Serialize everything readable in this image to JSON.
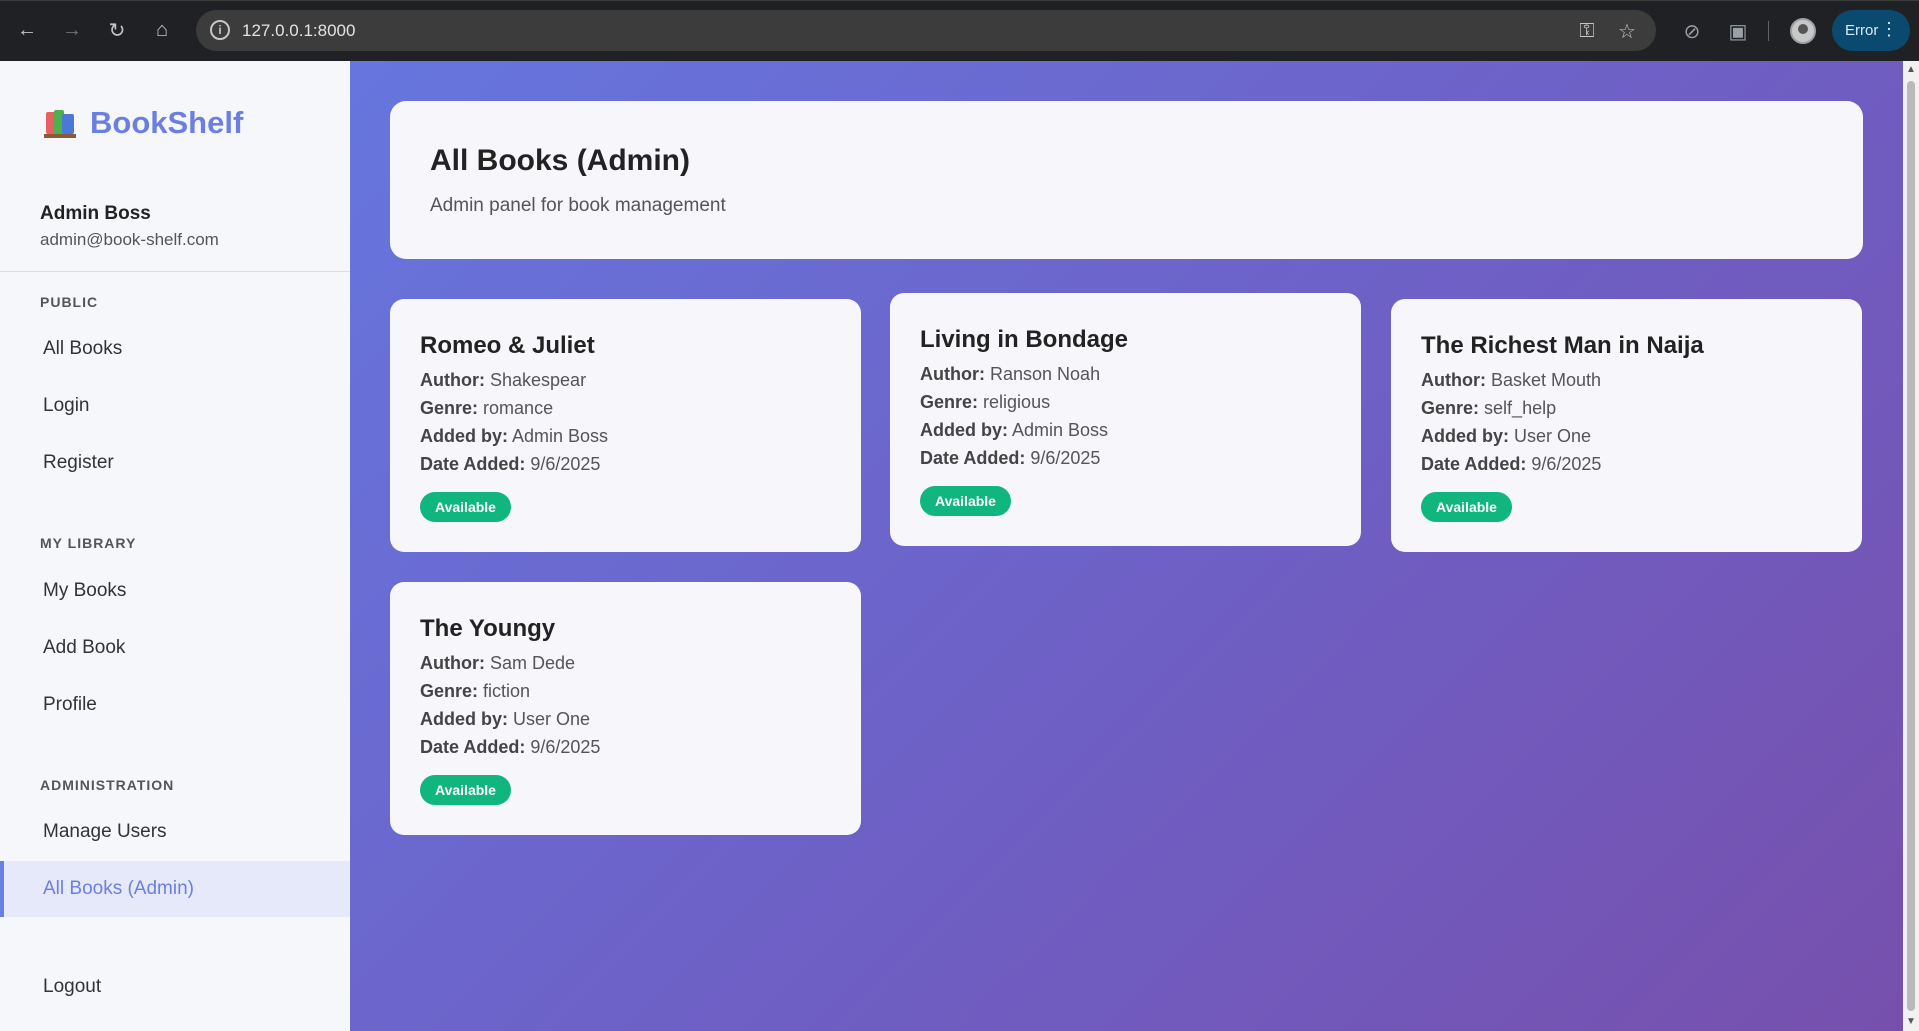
{
  "browser": {
    "url": "127.0.0.1:8000",
    "error_label": "Error",
    "icons": [
      "back-icon",
      "forward-icon",
      "reload-icon",
      "home-icon",
      "info-icon",
      "password-key-icon",
      "star-icon",
      "extension-blocked-icon",
      "puzzle-icon",
      "avatar",
      "more-vert-icon"
    ]
  },
  "sidebar": {
    "brand": "BookShelf",
    "user_name": "Admin Boss",
    "user_email": "admin@book-shelf.com",
    "sections": {
      "public": "PUBLIC",
      "my_library": "MY LIBRARY",
      "administration": "ADMINISTRATION"
    },
    "items": {
      "all_books": "All Books",
      "login": "Login",
      "register": "Register",
      "my_books": "My Books",
      "add_book": "Add Book",
      "profile": "Profile",
      "manage_users": "Manage Users",
      "all_books_admin": "All Books (Admin)",
      "logout": "Logout"
    },
    "active_item": "All Books (Admin)",
    "accent_color": "#6b7fe0"
  },
  "header": {
    "title": "All Books (Admin)",
    "subtitle": "Admin panel for book management"
  },
  "labels": {
    "author": "Author:",
    "genre": "Genre:",
    "added_by": "Added by:",
    "date_added": "Date Added:"
  },
  "books": [
    {
      "title": "Romeo & Juliet",
      "author": "Shakespear",
      "genre": "romance",
      "added_by": "Admin Boss",
      "date_added": "9/6/2025",
      "status": "Available"
    },
    {
      "title": "Living in Bondage",
      "author": "Ranson Noah",
      "genre": "religious",
      "added_by": "Admin Boss",
      "date_added": "9/6/2025",
      "status": "Available"
    },
    {
      "title": "The Richest Man in Naija",
      "author": "Basket Mouth",
      "genre": "self_help",
      "added_by": "User One",
      "date_added": "9/6/2025",
      "status": "Available"
    },
    {
      "title": "The Youngy",
      "author": "Sam Dede",
      "genre": "fiction",
      "added_by": "User One",
      "date_added": "9/6/2025",
      "status": "Available"
    }
  ],
  "colors": {
    "status_available": "#10b67e",
    "gradient_start": "#6676de",
    "gradient_end": "#7750ad"
  }
}
